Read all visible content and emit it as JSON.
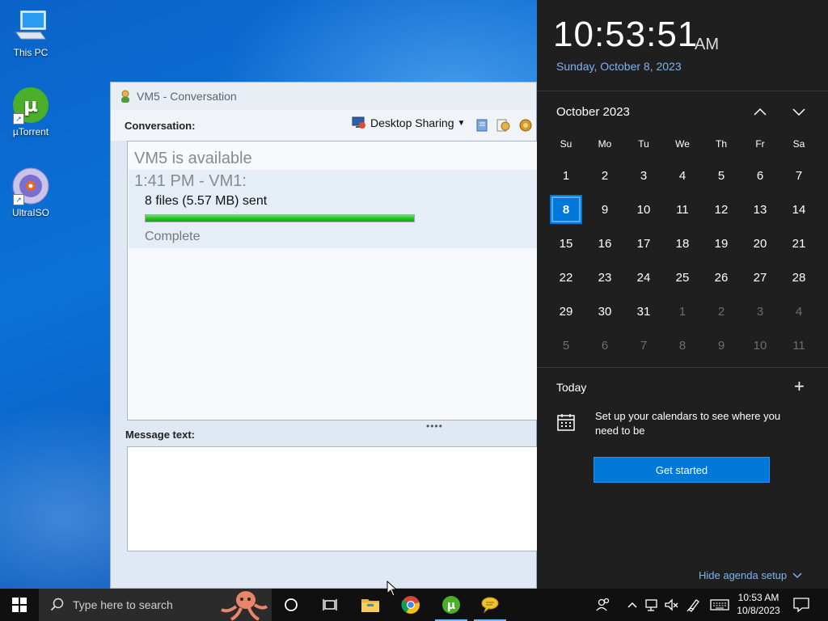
{
  "desktop": {
    "icons": [
      {
        "label": "This PC"
      },
      {
        "label": "µTorrent"
      },
      {
        "label": "UltraISO"
      }
    ]
  },
  "window": {
    "title": "VM5 - Conversation",
    "conversation_label": "Conversation:",
    "desktop_sharing_label": "Desktop Sharing",
    "status_line": "VM5 is available",
    "message_header": "1:41 PM - VM1:",
    "files_sent": "8 files (5.57 MB) sent",
    "progress": 1.0,
    "progress_status": "Complete",
    "splitter": "••••",
    "message_text_label": "Message text:"
  },
  "flyout": {
    "time": "10:53:51",
    "ampm": "AM",
    "date": "Sunday, October 8, 2023",
    "month": "October 2023",
    "weekdays": [
      "Su",
      "Mo",
      "Tu",
      "We",
      "Th",
      "Fr",
      "Sa"
    ],
    "weeks": [
      [
        "1",
        "2",
        "3",
        "4",
        "5",
        "6",
        "7"
      ],
      [
        "8",
        "9",
        "10",
        "11",
        "12",
        "13",
        "14"
      ],
      [
        "15",
        "16",
        "17",
        "18",
        "19",
        "20",
        "21"
      ],
      [
        "22",
        "23",
        "24",
        "25",
        "26",
        "27",
        "28"
      ],
      [
        "29",
        "30",
        "31",
        "1",
        "2",
        "3",
        "4"
      ],
      [
        "5",
        "6",
        "7",
        "8",
        "9",
        "10",
        "11"
      ]
    ],
    "today_label": "Today",
    "setup_text": "Set up your calendars to see where you need to be",
    "get_started": "Get started",
    "hide_agenda": "Hide agenda setup",
    "accent": "#0078d7"
  },
  "taskbar": {
    "search_placeholder": "Type here to search",
    "tray_time": "10:53 AM",
    "tray_date": "10/8/2023"
  }
}
